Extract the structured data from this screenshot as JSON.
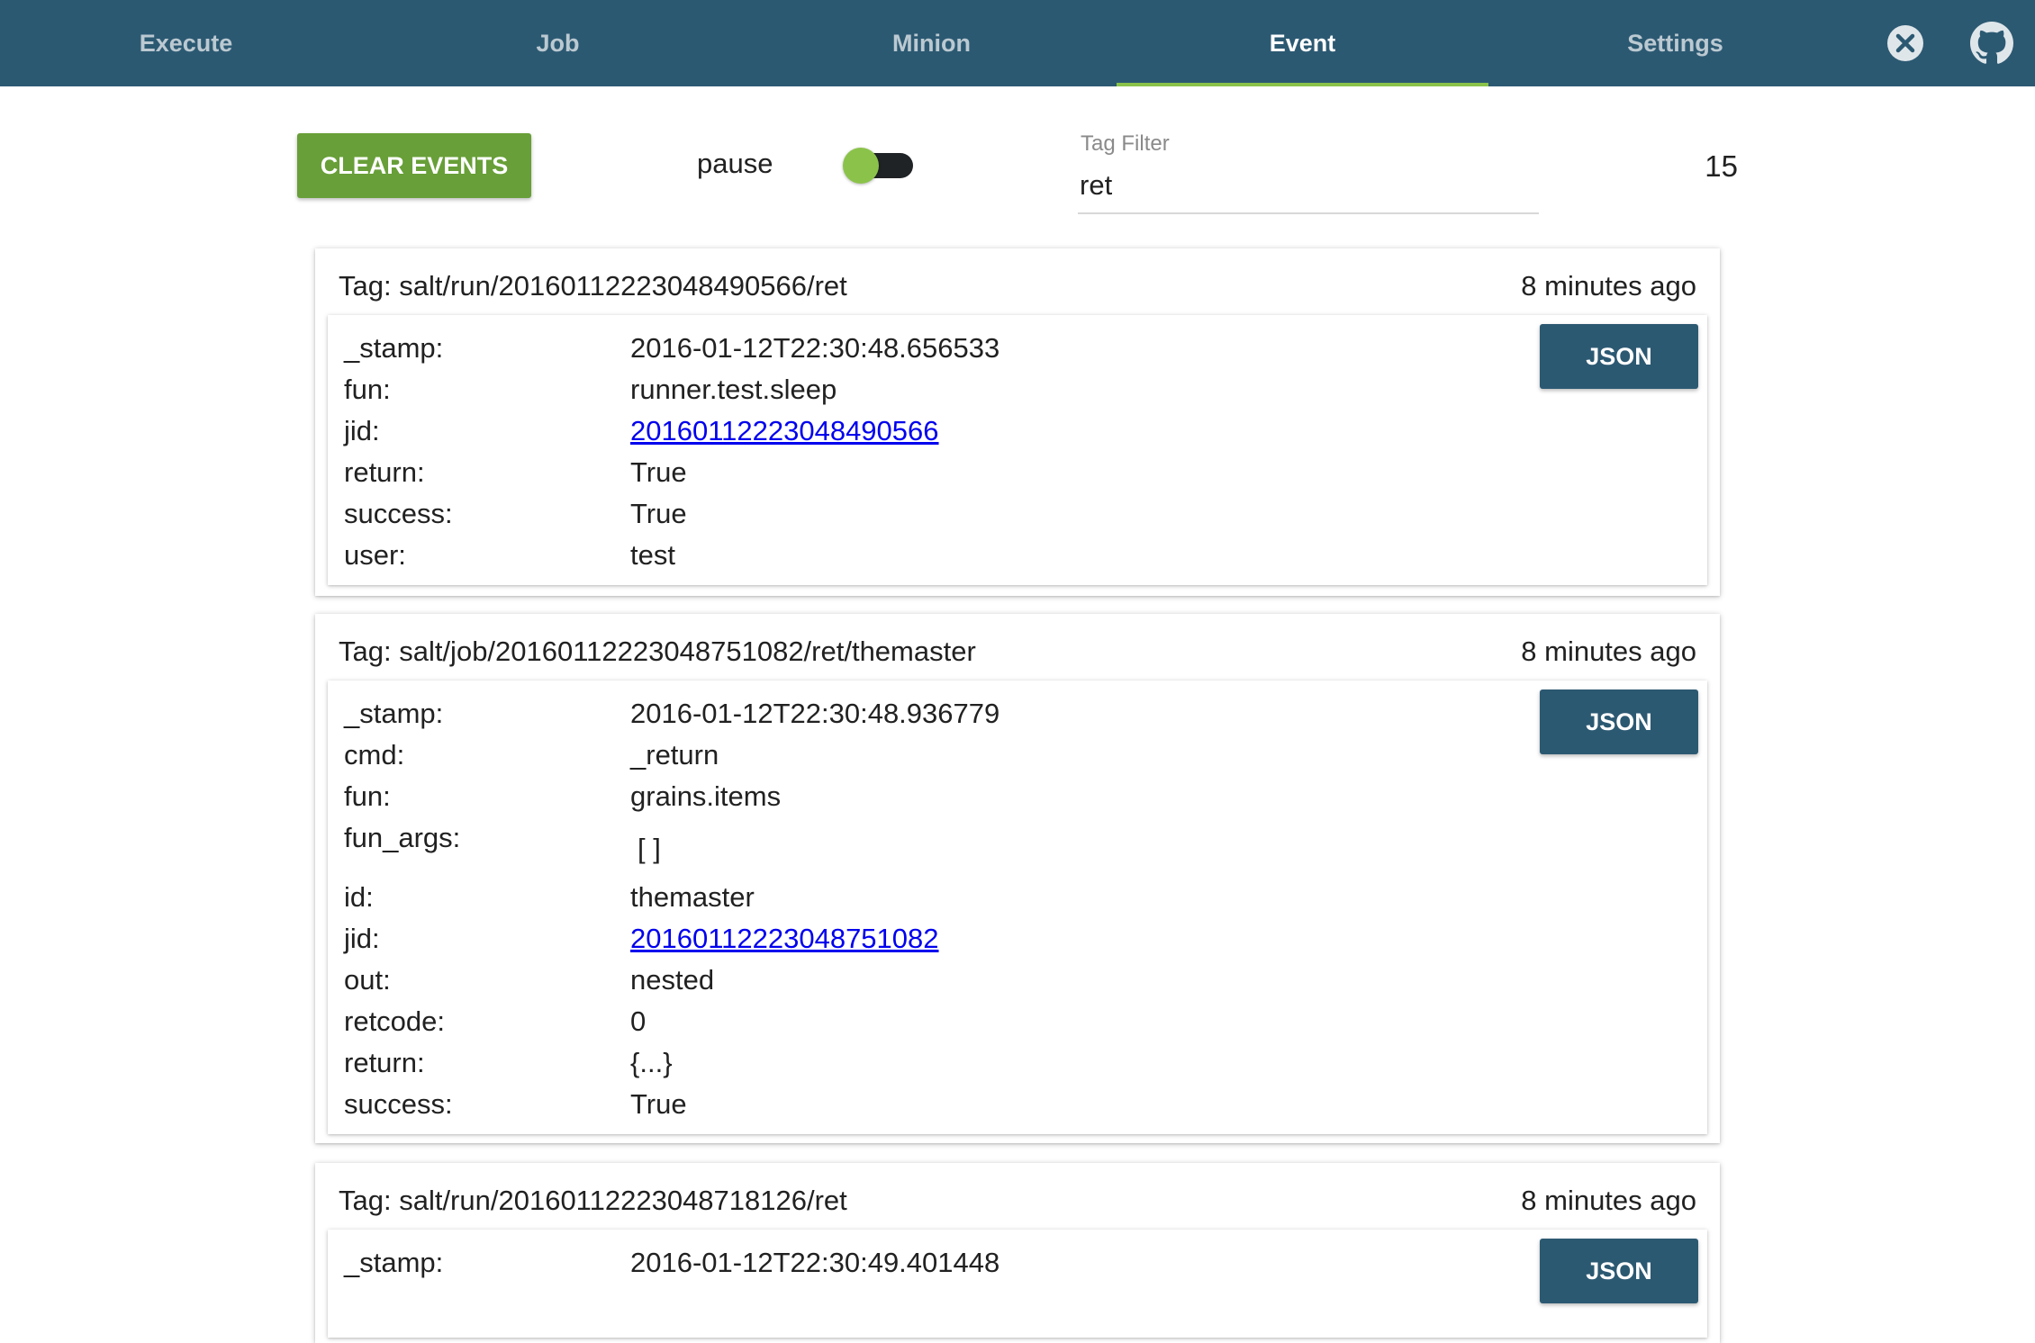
{
  "nav": {
    "tabs": [
      {
        "label": "Execute"
      },
      {
        "label": "Job"
      },
      {
        "label": "Minion"
      },
      {
        "label": "Event"
      },
      {
        "label": "Settings"
      }
    ],
    "active_tab": "Event",
    "icons": [
      "close-circle-icon",
      "github-icon"
    ]
  },
  "toolbar": {
    "clear_label": "CLEAR EVENTS",
    "pause_label": "pause",
    "pause_toggle_state": "on",
    "filter_label": "Tag Filter",
    "filter_value": "ret",
    "event_count": "15"
  },
  "colors": {
    "nav_bg": "#2c5972",
    "accent_green": "#689f38",
    "active_tab_underline": "#8bc34a",
    "json_button": "#2c5972",
    "link": "#0000ee"
  },
  "events": [
    {
      "tag": "Tag: salt/run/20160112223048490566/ret",
      "time": "8 minutes ago",
      "json_label": "JSON",
      "fields": [
        {
          "key": "_stamp:",
          "value": "2016-01-12T22:30:48.656533"
        },
        {
          "key": "fun:",
          "value": "runner.test.sleep"
        },
        {
          "key": "jid:",
          "value": "20160112223048490566"
        },
        {
          "key": "return:",
          "value": "True"
        },
        {
          "key": "success:",
          "value": "True"
        },
        {
          "key": "user:",
          "value": "test"
        }
      ]
    },
    {
      "tag": "Tag: salt/job/20160112223048751082/ret/themaster",
      "time": "8 minutes ago",
      "json_label": "JSON",
      "fields": [
        {
          "key": "_stamp:",
          "value": "2016-01-12T22:30:48.936779"
        },
        {
          "key": "cmd:",
          "value": "_return"
        },
        {
          "key": "fun:",
          "value": "grains.items"
        },
        {
          "key": "fun_args:",
          "value": "[ ]"
        },
        {
          "key": "id:",
          "value": "themaster"
        },
        {
          "key": "jid:",
          "value": "20160112223048751082"
        },
        {
          "key": "out:",
          "value": "nested"
        },
        {
          "key": "retcode:",
          "value": "0"
        },
        {
          "key": "return:",
          "value": "{...}"
        },
        {
          "key": "success:",
          "value": "True"
        }
      ]
    },
    {
      "tag": "Tag: salt/run/20160112223048718126/ret",
      "time": "8 minutes ago",
      "json_label": "JSON",
      "fields": [
        {
          "key": "_stamp:",
          "value": "2016-01-12T22:30:49.401448"
        }
      ]
    }
  ]
}
